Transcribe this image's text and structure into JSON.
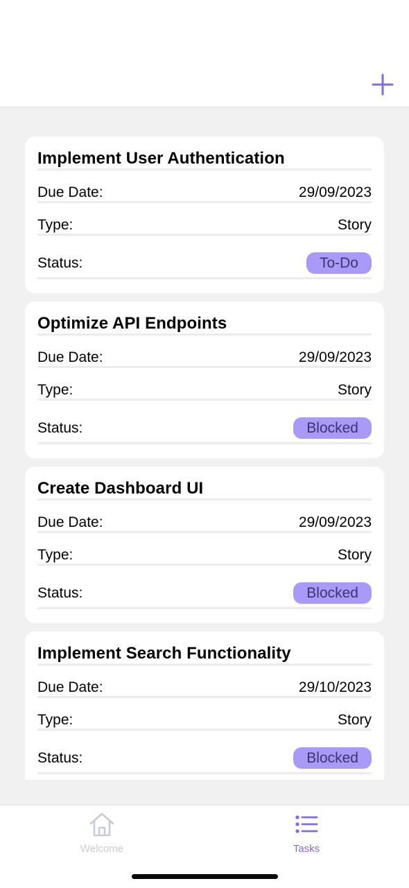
{
  "header": {
    "add_icon": "plus-icon",
    "accent_color": "#7d6ce6"
  },
  "tasks": [
    {
      "title": "Implement User Authentication",
      "due_label": "Due Date:",
      "due_date": "29/09/2023",
      "type_label": "Type:",
      "type": "Story",
      "status_label": "Status:",
      "status": "To-Do"
    },
    {
      "title": "Optimize API Endpoints",
      "due_label": "Due Date:",
      "due_date": "29/09/2023",
      "type_label": "Type:",
      "type": "Story",
      "status_label": "Status:",
      "status": "Blocked"
    },
    {
      "title": "Create Dashboard UI",
      "due_label": "Due Date:",
      "due_date": "29/09/2023",
      "type_label": "Type:",
      "type": "Story",
      "status_label": "Status:",
      "status": "Blocked"
    },
    {
      "title": "Implement Search Functionality",
      "due_label": "Due Date:",
      "due_date": "29/10/2023",
      "type_label": "Type:",
      "type": "Story",
      "status_label": "Status:",
      "status": "Blocked"
    }
  ],
  "status_pill_color": "#a99af7",
  "tabbar": {
    "tabs": [
      {
        "label": "Welcome",
        "icon": "home-icon",
        "active": false
      },
      {
        "label": "Tasks",
        "icon": "list-icon",
        "active": true
      }
    ],
    "active_color": "#7d6ce6",
    "inactive_color": "#c9cbd3"
  }
}
